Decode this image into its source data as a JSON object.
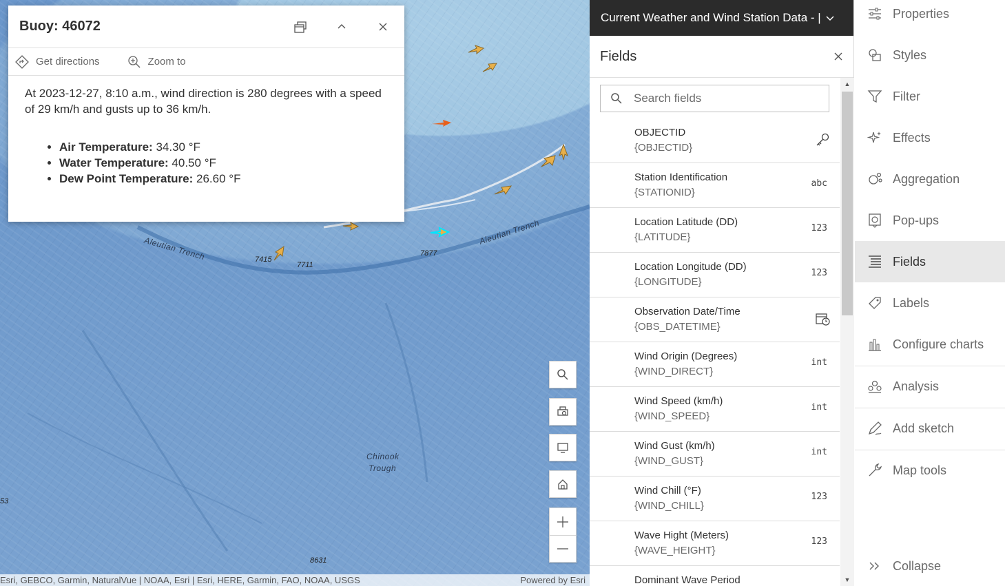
{
  "popup": {
    "title": "Buoy: 46072",
    "actions": {
      "directions": "Get directions",
      "zoom": "Zoom to"
    },
    "description": "At 2023-12-27, 8:10 a.m., wind direction is 280 degrees with a speed of 29 km/h and gusts up to 36 km/h.",
    "items": [
      {
        "label": "Air Temperature:",
        "value": " 34.30 °F"
      },
      {
        "label": "Water Temperature:",
        "value": " 40.50 °F"
      },
      {
        "label": "Dew Point Temperature:",
        "value": " 26.60 °F"
      }
    ]
  },
  "map": {
    "labels": {
      "trench_left": "Aleutian Trench",
      "trench_right": "Aleutian Trench",
      "chinook": "Chinook",
      "trough": "Trough"
    },
    "depths": [
      "7415",
      "7711",
      "7877",
      "53",
      "8631"
    ],
    "attribution_left": "Esri, GEBCO, Garmin, NaturalVue | NOAA, Esri | Esri, HERE, Garmin, FAO, NOAA, USGS",
    "attribution_right": "Powered by Esri"
  },
  "panel": {
    "layer_title": "Current Weather and Wind Station Data - |",
    "title": "Fields",
    "search_placeholder": "Search fields",
    "fields": [
      {
        "name": "OBJECTID",
        "alias": "{OBJECTID}",
        "type": "key-icon"
      },
      {
        "name": "Station Identification",
        "alias": "{STATIONID}",
        "type": "abc"
      },
      {
        "name": "Location Latitude (DD)",
        "alias": "{LATITUDE}",
        "type": "123"
      },
      {
        "name": "Location Longitude (DD)",
        "alias": "{LONGITUDE}",
        "type": "123"
      },
      {
        "name": "Observation Date/Time",
        "alias": "{OBS_DATETIME}",
        "type": "date-icon"
      },
      {
        "name": "Wind Origin (Degrees)",
        "alias": "{WIND_DIRECT}",
        "type": "int"
      },
      {
        "name": "Wind Speed (km/h)",
        "alias": "{WIND_SPEED}",
        "type": "int"
      },
      {
        "name": "Wind Gust (km/h)",
        "alias": "{WIND_GUST}",
        "type": "int"
      },
      {
        "name": "Wind Chill (°F)",
        "alias": "{WIND_CHILL}",
        "type": "123"
      },
      {
        "name": "Wave Hight (Meters)",
        "alias": "{WAVE_HEIGHT}",
        "type": "123"
      },
      {
        "name": "Dominant Wave Period",
        "alias": "",
        "type": ""
      }
    ]
  },
  "nav": {
    "items": [
      {
        "label": "Properties",
        "icon": "sliders-icon"
      },
      {
        "label": "Styles",
        "icon": "styles-icon"
      },
      {
        "label": "Filter",
        "icon": "filter-icon"
      },
      {
        "label": "Effects",
        "icon": "effects-icon"
      },
      {
        "label": "Aggregation",
        "icon": "aggregation-icon"
      },
      {
        "label": "Pop-ups",
        "icon": "popup-icon"
      },
      {
        "label": "Fields",
        "icon": "fields-icon"
      },
      {
        "label": "Labels",
        "icon": "label-icon"
      },
      {
        "label": "Configure charts",
        "icon": "chart-icon"
      },
      {
        "label": "Analysis",
        "icon": "analysis-icon"
      },
      {
        "label": "Add sketch",
        "icon": "sketch-icon"
      },
      {
        "label": "Map tools",
        "icon": "wrench-icon"
      }
    ],
    "collapse": "Collapse",
    "active": "Fields"
  },
  "colors": {
    "accent_dark": "#2b2b2b",
    "marker": "#e8b04a",
    "marker_selected": "#00ffff",
    "marker_hot": "#e8601c"
  }
}
